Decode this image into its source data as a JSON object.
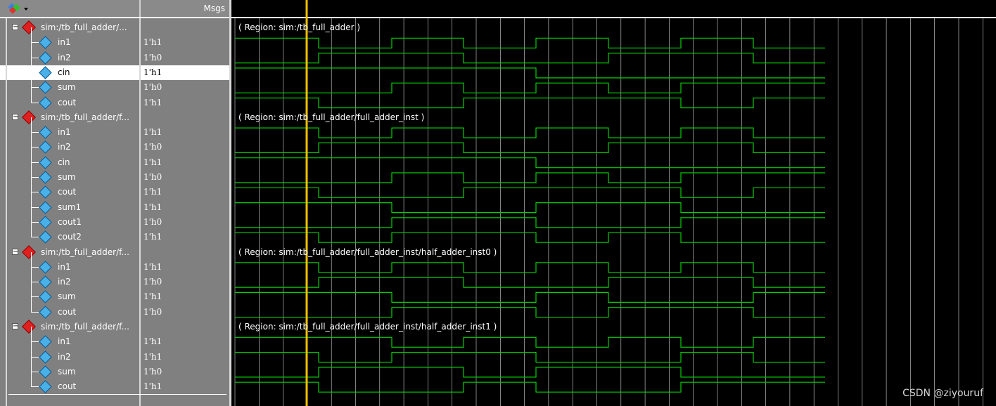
{
  "header": {
    "msgs_label": "Msgs",
    "logo_icon": "wave-group-icon"
  },
  "groups": [
    {
      "label": "sim:/tb_full_adder/...",
      "region": "( Region: sim:/tb_full_adder )",
      "signals": [
        {
          "name": "in1",
          "value": "1'h1"
        },
        {
          "name": "in2",
          "value": "1'h0"
        },
        {
          "name": "cin",
          "value": "1'h1",
          "selected": true
        },
        {
          "name": "sum",
          "value": "1'h0"
        },
        {
          "name": "cout",
          "value": "1'h1"
        }
      ]
    },
    {
      "label": "sim:/tb_full_adder/f...",
      "region": "( Region: sim:/tb_full_adder/full_adder_inst )",
      "signals": [
        {
          "name": "in1",
          "value": "1'h1"
        },
        {
          "name": "in2",
          "value": "1'h0"
        },
        {
          "name": "cin",
          "value": "1'h1"
        },
        {
          "name": "sum",
          "value": "1'h0"
        },
        {
          "name": "cout",
          "value": "1'h1"
        },
        {
          "name": "sum1",
          "value": "1'h1"
        },
        {
          "name": "cout1",
          "value": "1'h0"
        },
        {
          "name": "cout2",
          "value": "1'h1"
        }
      ]
    },
    {
      "label": "sim:/tb_full_adder/f...",
      "region": "( Region: sim:/tb_full_adder/full_adder_inst/half_adder_inst0 )",
      "signals": [
        {
          "name": "in1",
          "value": "1'h1"
        },
        {
          "name": "in2",
          "value": "1'h0"
        },
        {
          "name": "sum",
          "value": "1'h1"
        },
        {
          "name": "cout",
          "value": "1'h0"
        }
      ]
    },
    {
      "label": "sim:/tb_full_adder/f...",
      "region": "( Region: sim:/tb_full_adder/full_adder_inst/half_adder_inst1 )",
      "signals": [
        {
          "name": "in1",
          "value": "1'h1"
        },
        {
          "name": "in2",
          "value": "1'h1"
        },
        {
          "name": "sum",
          "value": "1'h0"
        },
        {
          "name": "cout",
          "value": "1'h1"
        }
      ]
    }
  ],
  "cursor": {
    "color": "#f0c000"
  },
  "colors": {
    "wave": "#00d000",
    "grid": "#ffffff",
    "background": "#000000"
  },
  "watermark": "CSDN @ziyouruf"
}
